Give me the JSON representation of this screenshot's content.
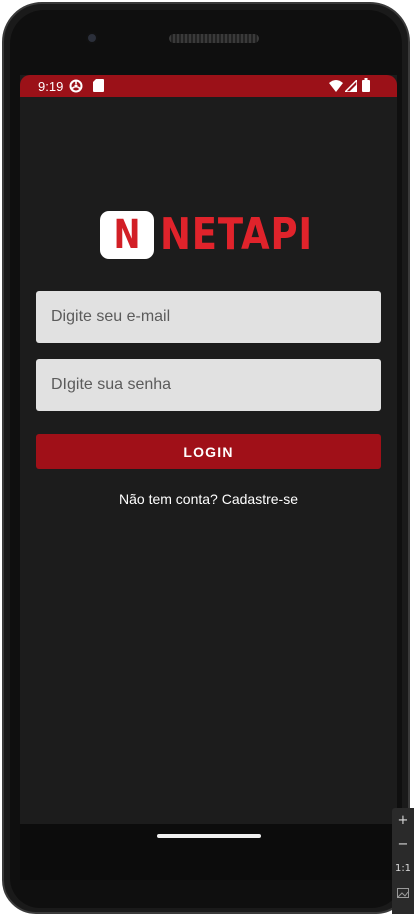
{
  "status_bar": {
    "time": "9:19",
    "icons": [
      "settings-icon",
      "sd-card-icon",
      "wifi-icon",
      "signal-icon",
      "battery-icon"
    ]
  },
  "logo": {
    "badge_letter": "N",
    "text": "NETAPI"
  },
  "form": {
    "email_placeholder": "Digite seu e-mail",
    "password_placeholder": "DIgite sua senha",
    "login_label": "LOGIN",
    "signup_text": "Não tem conta? Cadastre-se"
  },
  "emulator_toolbar": {
    "zoom_in": "+",
    "zoom_out": "−",
    "actual_size": "1:1"
  },
  "colors": {
    "status_bar": "#9b1118",
    "accent": "#e0232b",
    "button": "#a01018",
    "background": "#1c1c1c",
    "input_bg": "#e1e1e1"
  }
}
